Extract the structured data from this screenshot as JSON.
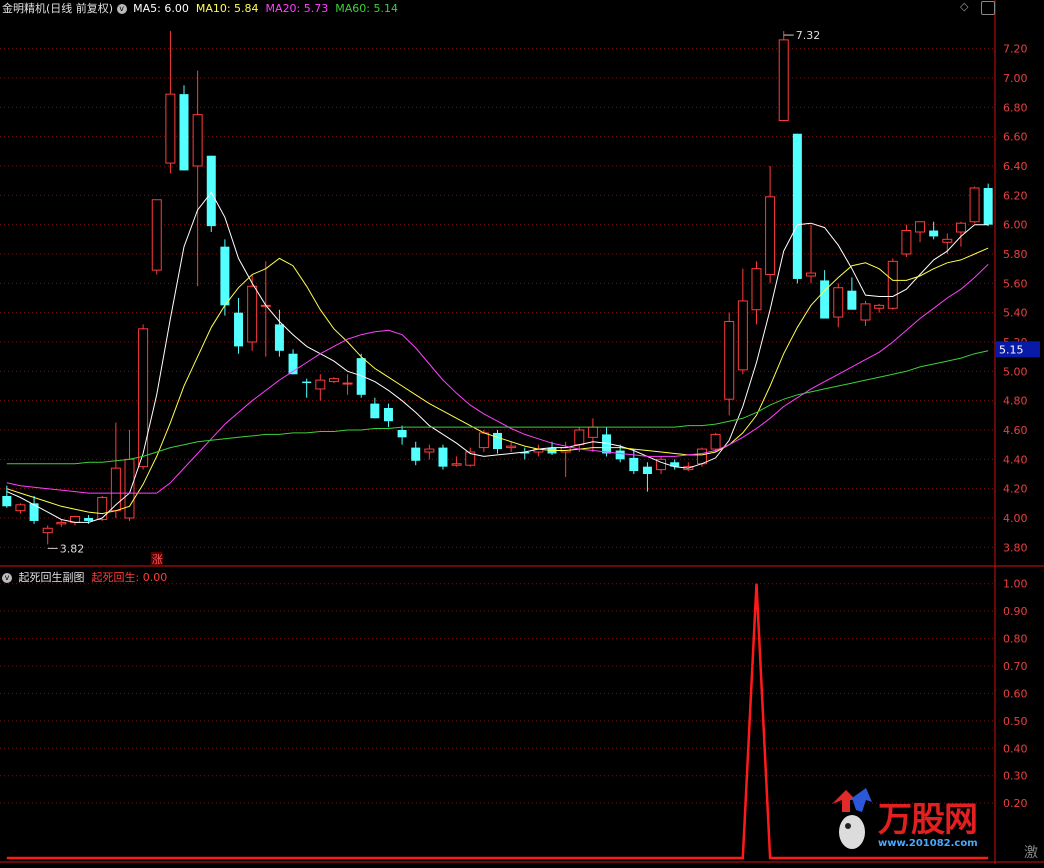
{
  "header": {
    "title": "金明精机(日线 前复权)",
    "ma5_label": "MA5:",
    "ma5_value": "6.00",
    "ma10_label": "MA10:",
    "ma10_value": "5.84",
    "ma20_label": "MA20:",
    "ma20_value": "5.73",
    "ma60_label": "MA60:",
    "ma60_value": "5.14"
  },
  "sub_header": {
    "title": "起死回生副图",
    "indicator_label": "起死回生:",
    "indicator_value": "0.00"
  },
  "annotations": {
    "high_label": "7.32",
    "low_label": "3.82",
    "limit_up_badge": "涨",
    "current_price": "5.15"
  },
  "watermark": {
    "brand": "万股网",
    "url": "www.201082.com",
    "corner_char": "激"
  },
  "colors": {
    "up": "#ff3b3b",
    "down": "#54ffff",
    "ma5": "#ffffff",
    "ma10": "#ffff4c",
    "ma20": "#ff40ff",
    "ma60": "#3cd13c",
    "axis": "#d01010",
    "grid": "#7a1010",
    "signal": "#ff1a1a",
    "price_tag_bg": "#0a1aa8"
  },
  "chart_data": [
    {
      "type": "candlestick",
      "title": "金明精机(日线 前复权)",
      "y_ticks": [
        "3.80",
        "4.00",
        "4.20",
        "4.40",
        "4.60",
        "4.80",
        "5.00",
        "5.20",
        "5.40",
        "5.60",
        "5.80",
        "6.00",
        "6.20",
        "6.40",
        "6.60",
        "6.80",
        "7.00",
        "7.20"
      ],
      "ylim": [
        3.7,
        7.45
      ],
      "candles": [
        [
          4.15,
          4.22,
          4.07,
          4.08
        ],
        [
          4.05,
          4.1,
          4.03,
          4.09
        ],
        [
          4.1,
          4.15,
          3.96,
          3.98
        ],
        [
          3.9,
          3.95,
          3.82,
          3.93
        ],
        [
          3.96,
          3.99,
          3.94,
          3.97
        ],
        [
          3.97,
          4.01,
          3.95,
          4.01
        ],
        [
          4.0,
          4.02,
          3.96,
          3.98
        ],
        [
          3.99,
          4.15,
          3.98,
          4.14
        ],
        [
          4.05,
          4.65,
          4.0,
          4.34
        ],
        [
          4.0,
          4.6,
          3.98,
          4.4
        ],
        [
          4.35,
          5.32,
          4.33,
          5.29
        ],
        [
          5.69,
          6.17,
          5.66,
          6.17
        ],
        [
          6.42,
          7.32,
          6.35,
          6.89
        ],
        [
          6.89,
          6.95,
          6.37,
          6.37
        ],
        [
          6.4,
          7.05,
          5.58,
          6.75
        ],
        [
          6.47,
          6.47,
          5.95,
          5.99
        ],
        [
          5.85,
          5.9,
          5.38,
          5.45
        ],
        [
          5.4,
          5.5,
          5.12,
          5.17
        ],
        [
          5.2,
          5.66,
          5.14,
          5.58
        ],
        [
          5.45,
          5.75,
          5.1,
          5.45
        ],
        [
          5.32,
          5.42,
          5.1,
          5.14
        ],
        [
          5.12,
          5.15,
          4.98,
          4.98
        ],
        [
          4.93,
          4.95,
          4.82,
          4.92
        ],
        [
          4.88,
          4.98,
          4.8,
          4.94
        ],
        [
          4.93,
          4.96,
          4.92,
          4.95
        ],
        [
          4.92,
          4.98,
          4.84,
          4.92
        ],
        [
          5.09,
          5.12,
          4.82,
          4.84
        ],
        [
          4.78,
          4.82,
          4.68,
          4.68
        ],
        [
          4.75,
          4.78,
          4.62,
          4.66
        ],
        [
          4.6,
          4.63,
          4.5,
          4.55
        ],
        [
          4.48,
          4.52,
          4.36,
          4.39
        ],
        [
          4.45,
          4.5,
          4.4,
          4.47
        ],
        [
          4.48,
          4.5,
          4.33,
          4.35
        ],
        [
          4.36,
          4.42,
          4.35,
          4.37
        ],
        [
          4.36,
          4.48,
          4.35,
          4.45
        ],
        [
          4.48,
          4.6,
          4.45,
          4.58
        ],
        [
          4.58,
          4.6,
          4.44,
          4.47
        ],
        [
          4.48,
          4.52,
          4.45,
          4.49
        ],
        [
          4.45,
          4.48,
          4.4,
          4.44
        ],
        [
          4.45,
          4.5,
          4.42,
          4.47
        ],
        [
          4.48,
          4.52,
          4.43,
          4.44
        ],
        [
          4.45,
          4.52,
          4.28,
          4.48
        ],
        [
          4.5,
          4.62,
          4.45,
          4.6
        ],
        [
          4.55,
          4.68,
          4.45,
          4.62
        ],
        [
          4.57,
          4.62,
          4.42,
          4.44
        ],
        [
          4.46,
          4.5,
          4.38,
          4.4
        ],
        [
          4.41,
          4.47,
          4.3,
          4.32
        ],
        [
          4.35,
          4.38,
          4.18,
          4.3
        ],
        [
          4.33,
          4.42,
          4.3,
          4.4
        ],
        [
          4.38,
          4.4,
          4.33,
          4.35
        ],
        [
          4.33,
          4.38,
          4.32,
          4.35
        ],
        [
          4.37,
          4.48,
          4.35,
          4.47
        ],
        [
          4.47,
          4.58,
          4.45,
          4.57
        ],
        [
          4.81,
          5.4,
          4.7,
          5.34
        ],
        [
          5.01,
          5.7,
          4.98,
          5.48
        ],
        [
          5.42,
          5.75,
          5.32,
          5.7
        ],
        [
          5.66,
          6.4,
          5.6,
          6.19
        ],
        [
          6.71,
          7.32,
          6.71,
          7.26
        ],
        [
          6.62,
          6.62,
          5.6,
          5.63
        ],
        [
          5.65,
          6.0,
          5.6,
          5.67
        ],
        [
          5.62,
          5.69,
          5.36,
          5.36
        ],
        [
          5.37,
          5.6,
          5.3,
          5.57
        ],
        [
          5.55,
          5.64,
          5.48,
          5.42
        ],
        [
          5.35,
          5.48,
          5.31,
          5.46
        ],
        [
          5.43,
          5.46,
          5.4,
          5.45
        ],
        [
          5.43,
          5.77,
          5.42,
          5.75
        ],
        [
          5.8,
          6.0,
          5.78,
          5.96
        ],
        [
          5.95,
          6.02,
          5.88,
          6.02
        ],
        [
          5.96,
          6.02,
          5.9,
          5.92
        ],
        [
          5.88,
          5.94,
          5.8,
          5.9
        ],
        [
          5.95,
          6.02,
          5.85,
          6.01
        ],
        [
          6.02,
          6.26,
          6.01,
          6.25
        ],
        [
          6.25,
          6.28,
          5.99,
          6.0
        ]
      ],
      "series": [
        {
          "name": "MA5",
          "values": [
            4.18,
            4.14,
            4.09,
            4.04,
            3.99,
            3.97,
            3.97,
            4.0,
            4.09,
            4.17,
            4.44,
            4.84,
            5.36,
            5.85,
            6.1,
            6.22,
            6.05,
            5.77,
            5.6,
            5.45,
            5.34,
            5.25,
            5.17,
            5.12,
            5.07,
            5.0,
            4.97,
            4.93,
            4.87,
            4.8,
            4.72,
            4.63,
            4.57,
            4.51,
            4.44,
            4.42,
            4.43,
            4.44,
            4.45,
            4.47,
            4.48,
            4.48,
            4.5,
            4.52,
            4.51,
            4.49,
            4.46,
            4.42,
            4.38,
            4.35,
            4.34,
            4.37,
            4.41,
            4.53,
            4.76,
            5.06,
            5.42,
            5.82,
            6.0,
            6.01,
            5.98,
            5.86,
            5.7,
            5.52,
            5.51,
            5.51,
            5.56,
            5.66,
            5.76,
            5.82,
            5.92,
            6.0,
            6.0
          ]
        },
        {
          "name": "MA10",
          "values": [
            4.2,
            4.17,
            4.14,
            4.11,
            4.08,
            4.06,
            4.04,
            4.03,
            4.05,
            4.08,
            4.23,
            4.42,
            4.65,
            4.9,
            5.1,
            5.3,
            5.45,
            5.57,
            5.66,
            5.7,
            5.77,
            5.72,
            5.58,
            5.42,
            5.29,
            5.2,
            5.1,
            5.02,
            4.96,
            4.9,
            4.84,
            4.78,
            4.73,
            4.68,
            4.63,
            4.58,
            4.55,
            4.52,
            4.49,
            4.47,
            4.46,
            4.46,
            4.47,
            4.48,
            4.48,
            4.48,
            4.47,
            4.46,
            4.45,
            4.44,
            4.43,
            4.43,
            4.45,
            4.5,
            4.58,
            4.7,
            4.9,
            5.12,
            5.3,
            5.45,
            5.55,
            5.64,
            5.72,
            5.74,
            5.7,
            5.62,
            5.62,
            5.65,
            5.7,
            5.74,
            5.76,
            5.8,
            5.84
          ]
        },
        {
          "name": "MA20",
          "values": [
            4.24,
            4.22,
            4.21,
            4.2,
            4.19,
            4.18,
            4.17,
            4.17,
            4.17,
            4.17,
            4.17,
            4.17,
            4.24,
            4.34,
            4.44,
            4.54,
            4.64,
            4.72,
            4.8,
            4.87,
            4.94,
            5.0,
            5.06,
            5.12,
            5.17,
            5.22,
            5.25,
            5.27,
            5.28,
            5.25,
            5.16,
            5.05,
            4.94,
            4.85,
            4.77,
            4.71,
            4.66,
            4.61,
            4.57,
            4.54,
            4.51,
            4.49,
            4.47,
            4.46,
            4.45,
            4.44,
            4.43,
            4.42,
            4.42,
            4.42,
            4.43,
            4.44,
            4.46,
            4.5,
            4.55,
            4.61,
            4.68,
            4.76,
            4.82,
            4.88,
            4.93,
            4.98,
            5.03,
            5.08,
            5.13,
            5.2,
            5.28,
            5.36,
            5.43,
            5.5,
            5.56,
            5.64,
            5.73
          ]
        },
        {
          "name": "MA60",
          "values": [
            4.37,
            4.37,
            4.37,
            4.37,
            4.37,
            4.37,
            4.38,
            4.38,
            4.39,
            4.4,
            4.42,
            4.45,
            4.48,
            4.5,
            4.52,
            4.53,
            4.54,
            4.55,
            4.56,
            4.57,
            4.57,
            4.58,
            4.58,
            4.59,
            4.59,
            4.6,
            4.6,
            4.61,
            4.61,
            4.62,
            4.62,
            4.62,
            4.62,
            4.62,
            4.62,
            4.62,
            4.62,
            4.62,
            4.62,
            4.62,
            4.62,
            4.62,
            4.62,
            4.62,
            4.62,
            4.62,
            4.62,
            4.62,
            4.62,
            4.62,
            4.63,
            4.63,
            4.64,
            4.66,
            4.68,
            4.72,
            4.77,
            4.81,
            4.84,
            4.86,
            4.88,
            4.9,
            4.92,
            4.94,
            4.96,
            4.98,
            5.0,
            5.03,
            5.05,
            5.07,
            5.09,
            5.12,
            5.14
          ]
        }
      ]
    },
    {
      "type": "line",
      "title": "起死回生副图",
      "y_ticks": [
        "0.20",
        "0.30",
        "0.40",
        "0.50",
        "0.60",
        "0.70",
        "0.80",
        "0.90",
        "1.00"
      ],
      "ylim": [
        0,
        1.05
      ],
      "series": [
        {
          "name": "起死回生",
          "values": [
            0,
            0,
            0,
            0,
            0,
            0,
            0,
            0,
            0,
            0,
            0,
            0,
            0,
            0,
            0,
            0,
            0,
            0,
            0,
            0,
            0,
            0,
            0,
            0,
            0,
            0,
            0,
            0,
            0,
            0,
            0,
            0,
            0,
            0,
            0,
            0,
            0,
            0,
            0,
            0,
            0,
            0,
            0,
            0,
            0,
            0,
            0,
            0,
            0,
            0,
            0,
            0,
            0,
            0,
            0,
            1,
            0,
            0,
            0,
            0,
            0,
            0,
            0,
            0,
            0,
            0,
            0,
            0,
            0,
            0,
            0,
            0,
            0
          ]
        }
      ]
    }
  ]
}
